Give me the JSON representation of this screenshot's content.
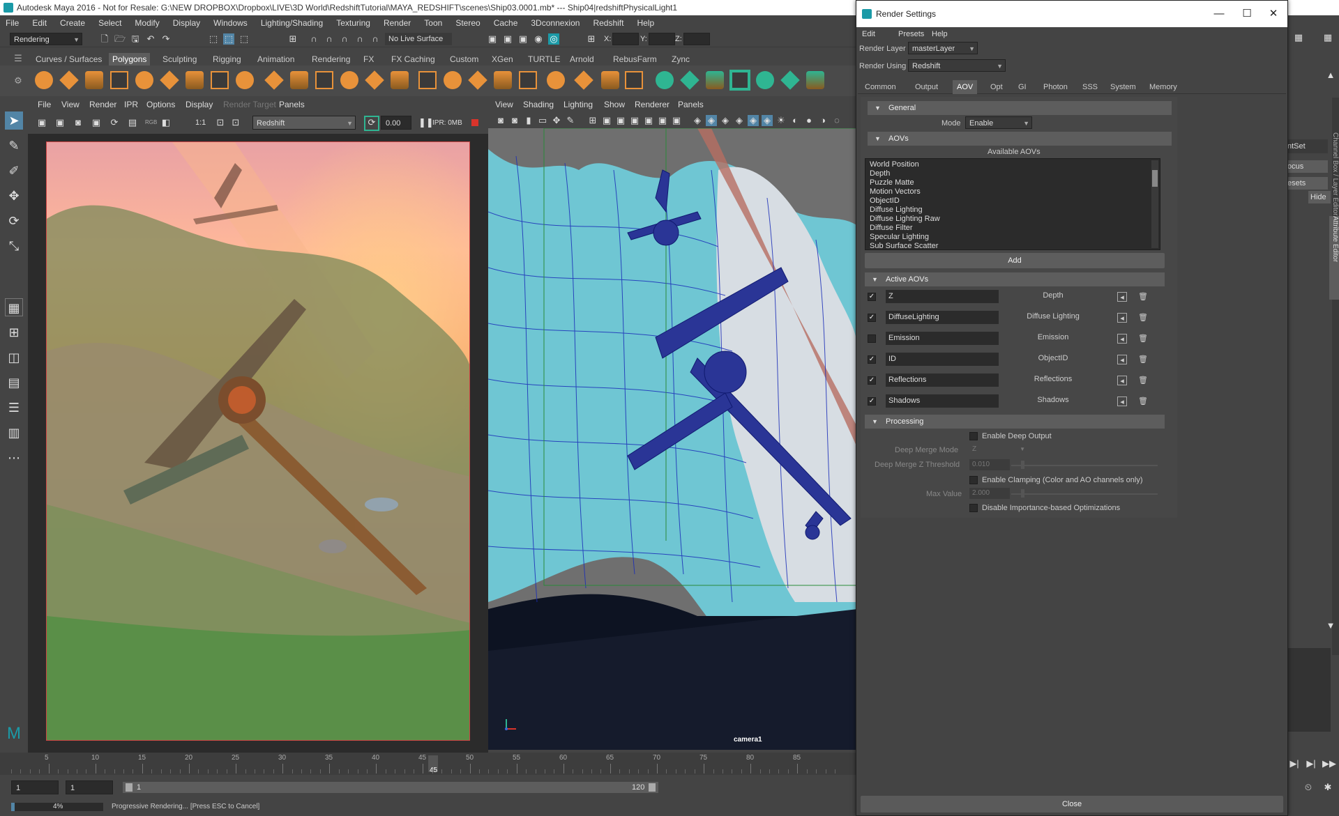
{
  "window_title": "Autodesk Maya 2016 - Not for Resale: G:\\NEW DROPBOX\\Dropbox\\LIVE\\3D World\\RedshiftTutorial\\MAYA_REDSHIFT\\scenes\\Ship03.0001.mb* --- Ship04|redshiftPhysicalLight1",
  "main_menu": [
    "File",
    "Edit",
    "Create",
    "Select",
    "Modify",
    "Display",
    "Windows",
    "Lighting/Shading",
    "Texturing",
    "Render",
    "Toon",
    "Stereo",
    "Cache",
    "3Dconnexion",
    "Redshift",
    "Help"
  ],
  "status_line": {
    "menu_set": "Rendering",
    "live_surface": "No Live Surface",
    "x_label": "X:",
    "y_label": "Y:",
    "z_label": "Z:"
  },
  "shelf_tabs": [
    "Curves / Surfaces",
    "Polygons",
    "Sculpting",
    "Rigging",
    "Animation",
    "Rendering",
    "FX",
    "FX Caching",
    "Custom",
    "XGen",
    "TURTLE",
    "Arnold",
    "RebusFarm",
    "Zync"
  ],
  "shelf_active_tab": "Polygons",
  "render_view": {
    "menu": [
      "File",
      "View",
      "Render",
      "IPR",
      "Options",
      "Display",
      "Render Target",
      "Panels"
    ],
    "ratio": "1:1",
    "renderer": "Redshift",
    "exposure": "0.00",
    "ipr_memory": "IPR: 0MB",
    "rgb_label": "RGB"
  },
  "viewport": {
    "menu": [
      "View",
      "Shading",
      "Lighting",
      "Show",
      "Renderer",
      "Panels"
    ],
    "camera_label": "camera1"
  },
  "time_slider": {
    "ticks": [
      "5",
      "10",
      "15",
      "20",
      "25",
      "30",
      "35",
      "40",
      "45",
      "50",
      "55",
      "60",
      "65",
      "70",
      "75",
      "80",
      "85"
    ],
    "current_frame": "45"
  },
  "range_slider": {
    "start": "1",
    "start_inner": "1",
    "range_start": "1",
    "range_end": "120"
  },
  "help_line": {
    "progress_pct": "4%",
    "progress_fraction": 0.04,
    "message": "Progressive Rendering... [Press ESC to Cancel]"
  },
  "right_strip": {
    "labels": [
      "ntSet",
      "ocus",
      "esets",
      "Hide"
    ],
    "vertical_tabs": [
      "Channel Box / Layer Editor",
      "Attribute Editor"
    ]
  },
  "render_settings": {
    "title": "Render Settings",
    "window_buttons": [
      "—",
      "☐",
      "✕"
    ],
    "menu": [
      "Edit",
      "Presets",
      "Help"
    ],
    "render_layer_label": "Render Layer",
    "render_layer_value": "masterLayer",
    "render_using_label": "Render Using",
    "render_using_value": "Redshift",
    "tabs": [
      "Common",
      "Output",
      "AOV",
      "Opt",
      "GI",
      "Photon",
      "SSS",
      "System",
      "Memory"
    ],
    "active_tab": "AOV",
    "general": {
      "header": "General",
      "mode_label": "Mode",
      "mode_value": "Enable"
    },
    "aovs": {
      "header": "AOVs",
      "available_label": "Available AOVs",
      "available": [
        "World Position",
        "Depth",
        "Puzzle Matte",
        "Motion Vectors",
        "ObjectID",
        "Diffuse Lighting",
        "Diffuse Lighting Raw",
        "Diffuse Filter",
        "Specular Lighting",
        "Sub Surface Scatter"
      ],
      "add_label": "Add"
    },
    "active_aovs": {
      "header": "Active AOVs",
      "rows": [
        {
          "name": "Z",
          "type": "Depth",
          "enabled": true
        },
        {
          "name": "DiffuseLighting",
          "type": "Diffuse Lighting",
          "enabled": true
        },
        {
          "name": "Emission",
          "type": "Emission",
          "enabled": false
        },
        {
          "name": "ID",
          "type": "ObjectID",
          "enabled": true
        },
        {
          "name": "Reflections",
          "type": "Reflections",
          "enabled": true
        },
        {
          "name": "Shadows",
          "type": "Shadows",
          "enabled": true
        }
      ]
    },
    "processing": {
      "header": "Processing",
      "enable_deep_output": "Enable Deep Output",
      "deep_merge_mode_label": "Deep Merge Mode",
      "deep_merge_mode_value": "Z",
      "deep_merge_z_label": "Deep Merge Z Threshold",
      "deep_merge_z_value": "0.010",
      "enable_clamping": "Enable Clamping (Color and AO channels only)",
      "max_value_label": "Max Value",
      "max_value": "2.000",
      "disable_importance": "Disable Importance-based Optimizations"
    },
    "close_label": "Close"
  },
  "colors": {
    "maya_teal": "#1b9aa7",
    "shelf_orange": "#e8923a",
    "shelf_green": "#2fb592",
    "render_frame_red": "#cc4444",
    "wire_blue": "#1a2db8",
    "mesh_cyan": "#6fc6d3"
  }
}
